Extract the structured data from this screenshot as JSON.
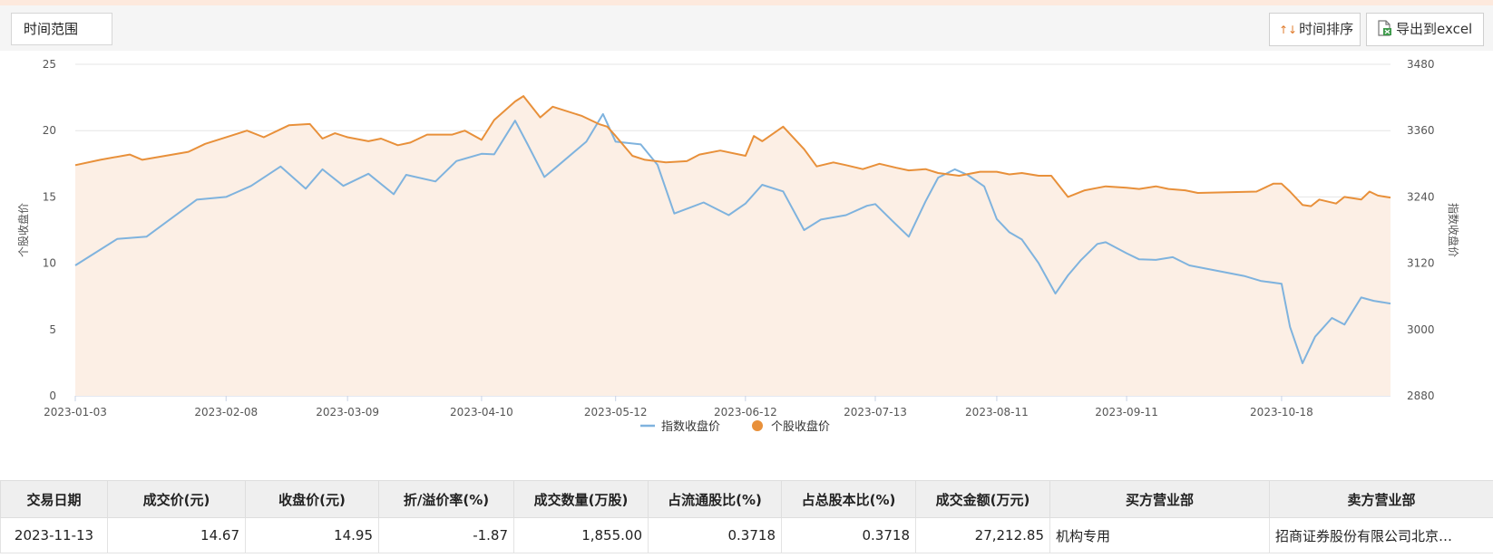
{
  "toolbar": {
    "range_label": "时间范围",
    "sort_label": "时间排序",
    "export_label": "导出到excel"
  },
  "chart_data": {
    "type": "area",
    "left_axis_label": "个股收盘价",
    "right_axis_label": "指数收盘价",
    "left_ylim": [
      0,
      25
    ],
    "right_ylim": [
      2880,
      3480
    ],
    "left_ticks": [
      0,
      5,
      10,
      15,
      20,
      25
    ],
    "right_ticks": [
      2880,
      3000,
      3120,
      3240,
      3360,
      3480
    ],
    "x_range": [
      "2023-01-03",
      "2023-11-13"
    ],
    "x_ticks": [
      "2023-01-03",
      "2023-02-08",
      "2023-03-09",
      "2023-04-10",
      "2023-05-12",
      "2023-06-12",
      "2023-07-13",
      "2023-08-11",
      "2023-09-11",
      "2023-10-18"
    ],
    "grid": true,
    "legend_position": "bottom-center",
    "colors": {
      "stock": "#e8903a",
      "index": "#7fb3de",
      "fill": "#fcefe5"
    },
    "series": [
      {
        "name": "指数收盘价",
        "axis": "right",
        "color": "#7fb3de",
        "points": [
          [
            "2023-01-03",
            3116
          ],
          [
            "2023-01-13",
            3164
          ],
          [
            "2023-01-20",
            3168
          ],
          [
            "2023-02-01",
            3235
          ],
          [
            "2023-02-08",
            3240
          ],
          [
            "2023-02-14",
            3260
          ],
          [
            "2023-02-21",
            3295
          ],
          [
            "2023-02-27",
            3255
          ],
          [
            "2023-03-03",
            3290
          ],
          [
            "2023-03-08",
            3260
          ],
          [
            "2023-03-14",
            3282
          ],
          [
            "2023-03-20",
            3245
          ],
          [
            "2023-03-23",
            3280
          ],
          [
            "2023-03-30",
            3268
          ],
          [
            "2023-04-04",
            3305
          ],
          [
            "2023-04-10",
            3318
          ],
          [
            "2023-04-13",
            3317
          ],
          [
            "2023-04-18",
            3378
          ],
          [
            "2023-04-21",
            3335
          ],
          [
            "2023-04-25",
            3276
          ],
          [
            "2023-04-28",
            3295
          ],
          [
            "2023-05-05",
            3340
          ],
          [
            "2023-05-09",
            3390
          ],
          [
            "2023-05-12",
            3340
          ],
          [
            "2023-05-18",
            3335
          ],
          [
            "2023-05-22",
            3298
          ],
          [
            "2023-05-26",
            3210
          ],
          [
            "2023-06-02",
            3230
          ],
          [
            "2023-06-08",
            3207
          ],
          [
            "2023-06-12",
            3228
          ],
          [
            "2023-06-16",
            3262
          ],
          [
            "2023-06-21",
            3250
          ],
          [
            "2023-06-26",
            3180
          ],
          [
            "2023-06-30",
            3199
          ],
          [
            "2023-07-06",
            3207
          ],
          [
            "2023-07-11",
            3224
          ],
          [
            "2023-07-13",
            3227
          ],
          [
            "2023-07-17",
            3197
          ],
          [
            "2023-07-21",
            3168
          ],
          [
            "2023-07-25",
            3232
          ],
          [
            "2023-07-28",
            3275
          ],
          [
            "2023-08-01",
            3290
          ],
          [
            "2023-08-04",
            3280
          ],
          [
            "2023-08-08",
            3259
          ],
          [
            "2023-08-11",
            3200
          ],
          [
            "2023-08-14",
            3176
          ],
          [
            "2023-08-17",
            3163
          ],
          [
            "2023-08-21",
            3120
          ],
          [
            "2023-08-25",
            3065
          ],
          [
            "2023-08-28",
            3098
          ],
          [
            "2023-08-31",
            3125
          ],
          [
            "2023-09-04",
            3155
          ],
          [
            "2023-09-06",
            3158
          ],
          [
            "2023-09-11",
            3138
          ],
          [
            "2023-09-14",
            3127
          ],
          [
            "2023-09-18",
            3126
          ],
          [
            "2023-09-22",
            3131
          ],
          [
            "2023-09-26",
            3116
          ],
          [
            "2023-10-09",
            3097
          ],
          [
            "2023-10-13",
            3088
          ],
          [
            "2023-10-18",
            3083
          ],
          [
            "2023-10-20",
            3005
          ],
          [
            "2023-10-23",
            2939
          ],
          [
            "2023-10-26",
            2987
          ],
          [
            "2023-10-30",
            3021
          ],
          [
            "2023-11-02",
            3009
          ],
          [
            "2023-11-06",
            3058
          ],
          [
            "2023-11-09",
            3052
          ],
          [
            "2023-11-13",
            3047
          ]
        ]
      },
      {
        "name": "个股收盘价",
        "axis": "left",
        "color": "#e8903a",
        "points": [
          [
            "2023-01-03",
            17.4
          ],
          [
            "2023-01-09",
            17.8
          ],
          [
            "2023-01-16",
            18.2
          ],
          [
            "2023-01-19",
            17.8
          ],
          [
            "2023-01-30",
            18.4
          ],
          [
            "2023-02-03",
            19.0
          ],
          [
            "2023-02-09",
            19.6
          ],
          [
            "2023-02-13",
            20.0
          ],
          [
            "2023-02-17",
            19.5
          ],
          [
            "2023-02-23",
            20.4
          ],
          [
            "2023-02-28",
            20.5
          ],
          [
            "2023-03-03",
            19.4
          ],
          [
            "2023-03-06",
            19.8
          ],
          [
            "2023-03-09",
            19.5
          ],
          [
            "2023-03-14",
            19.2
          ],
          [
            "2023-03-17",
            19.4
          ],
          [
            "2023-03-21",
            18.9
          ],
          [
            "2023-03-24",
            19.1
          ],
          [
            "2023-03-28",
            19.7
          ],
          [
            "2023-04-03",
            19.7
          ],
          [
            "2023-04-06",
            20.0
          ],
          [
            "2023-04-10",
            19.3
          ],
          [
            "2023-04-13",
            20.8
          ],
          [
            "2023-04-18",
            22.2
          ],
          [
            "2023-04-20",
            22.6
          ],
          [
            "2023-04-24",
            21.0
          ],
          [
            "2023-04-27",
            21.8
          ],
          [
            "2023-05-04",
            21.1
          ],
          [
            "2023-05-08",
            20.5
          ],
          [
            "2023-05-10",
            20.3
          ],
          [
            "2023-05-12",
            19.6
          ],
          [
            "2023-05-16",
            18.1
          ],
          [
            "2023-05-19",
            17.8
          ],
          [
            "2023-05-24",
            17.6
          ],
          [
            "2023-05-29",
            17.7
          ],
          [
            "2023-06-01",
            18.2
          ],
          [
            "2023-06-06",
            18.5
          ],
          [
            "2023-06-12",
            18.1
          ],
          [
            "2023-06-14",
            19.6
          ],
          [
            "2023-06-16",
            19.2
          ],
          [
            "2023-06-21",
            20.3
          ],
          [
            "2023-06-26",
            18.6
          ],
          [
            "2023-06-29",
            17.3
          ],
          [
            "2023-07-03",
            17.6
          ],
          [
            "2023-07-06",
            17.4
          ],
          [
            "2023-07-10",
            17.1
          ],
          [
            "2023-07-14",
            17.5
          ],
          [
            "2023-07-18",
            17.2
          ],
          [
            "2023-07-21",
            17.0
          ],
          [
            "2023-07-25",
            17.1
          ],
          [
            "2023-07-28",
            16.8
          ],
          [
            "2023-08-02",
            16.6
          ],
          [
            "2023-08-07",
            16.9
          ],
          [
            "2023-08-11",
            16.9
          ],
          [
            "2023-08-14",
            16.7
          ],
          [
            "2023-08-17",
            16.8
          ],
          [
            "2023-08-21",
            16.6
          ],
          [
            "2023-08-24",
            16.6
          ],
          [
            "2023-08-28",
            15.0
          ],
          [
            "2023-09-01",
            15.5
          ],
          [
            "2023-09-06",
            15.8
          ],
          [
            "2023-09-11",
            15.7
          ],
          [
            "2023-09-14",
            15.6
          ],
          [
            "2023-09-18",
            15.8
          ],
          [
            "2023-09-21",
            15.6
          ],
          [
            "2023-09-25",
            15.5
          ],
          [
            "2023-09-28",
            15.3
          ],
          [
            "2023-10-12",
            15.4
          ],
          [
            "2023-10-16",
            16.0
          ],
          [
            "2023-10-18",
            16.0
          ],
          [
            "2023-10-20",
            15.4
          ],
          [
            "2023-10-23",
            14.4
          ],
          [
            "2023-10-25",
            14.3
          ],
          [
            "2023-10-27",
            14.8
          ],
          [
            "2023-10-31",
            14.5
          ],
          [
            "2023-11-02",
            15.0
          ],
          [
            "2023-11-06",
            14.8
          ],
          [
            "2023-11-08",
            15.4
          ],
          [
            "2023-11-10",
            15.1
          ],
          [
            "2023-11-13",
            14.95
          ]
        ]
      }
    ]
  },
  "table": {
    "headers": [
      "交易日期",
      "成交价(元)",
      "收盘价(元)",
      "折/溢价率(%)",
      "成交数量(万股)",
      "占流通股比(%)",
      "占总股本比(%)",
      "成交金额(万元)",
      "买方营业部",
      "卖方营业部"
    ],
    "rows": [
      [
        "2023-11-13",
        "14.67",
        "14.95",
        "-1.87",
        "1,855.00",
        "0.3718",
        "0.3718",
        "27,212.85",
        "机构专用",
        "招商证券股份有限公司北京…"
      ]
    ]
  }
}
